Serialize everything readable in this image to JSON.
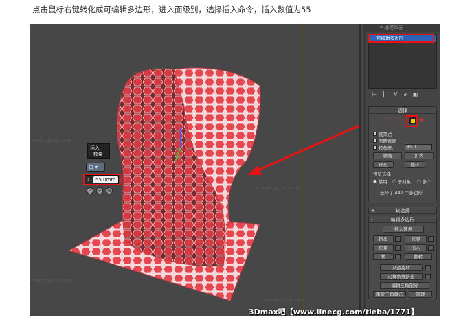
{
  "caption": "点击鼠标右键转化成可编辑多边形，进入面级别，选择插入命令，插入数值为55",
  "watermark": "moxingyun.com",
  "viewport_logo": "三维模型云",
  "caddy": {
    "title_line1": "插入",
    "title_line2": "- 数量",
    "mode_icon": "grid-icon",
    "value": "55.0mm",
    "ok_label": "✓",
    "apply_label": "+",
    "cancel_label": "⊗"
  },
  "panel": {
    "topbar": "三维模型云",
    "stack_item": "可编辑多边形",
    "icons": [
      "pin-icon",
      "separator-icon",
      "show-end-icon",
      "make-unique-icon",
      "configure-icon"
    ],
    "selection": {
      "title": "选择",
      "by_vertex": "按顶点",
      "ignore_backfacing": "忽略背面",
      "by_angle": "按角度:",
      "angle_value": "45.0",
      "shrink": "收缩",
      "grow": "扩大",
      "ring": "环形",
      "loop": "循环",
      "preview_label": "预览选择",
      "preview_off": "禁用",
      "preview_subobj": "子对象",
      "preview_multi": "多个",
      "status": "选择了 441 个多边形"
    },
    "soft_selection": "软选择",
    "edit_polygons": {
      "title": "编辑多边形",
      "insert_vertex": "插入顶点",
      "extrude": "挤出",
      "outline": "轮廓",
      "bevel": "倒角",
      "inset": "插入",
      "bridge": "桥",
      "flip": "翻转",
      "hinge": "从边旋转",
      "extrude_spline": "沿样条线挤出",
      "edit_tri": "编辑三角剖分",
      "retriangulate": "重复三角算法",
      "turn": "旋转"
    }
  },
  "banner": "3Dmax吧【www.linecg.com/tieba/1771】",
  "colors": {
    "accent_red": "#e11111",
    "mesh_red": "#e8474f",
    "selected_blue": "#2a64b8"
  }
}
